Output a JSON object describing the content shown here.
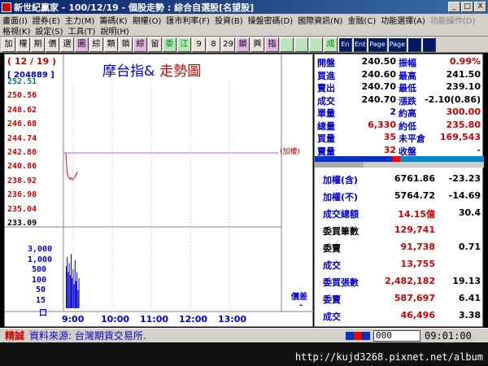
{
  "window": {
    "title": "新世紀贏家 - 100/12/19 - 個股走勢 : 綜合自選股[名望股]",
    "controls": [
      "_",
      "□",
      "X"
    ]
  },
  "menu1": [
    "畫面(I)",
    "證券(E)",
    "主力(M)",
    "籌碼(K)",
    "期權(O)",
    "匯市利率(F)",
    "投資(B)",
    "操盤密碼(D)",
    "國際資訊(N)",
    "金融(C)",
    "功能選擇(A)"
  ],
  "menu1_disabled": "功能操作(D)",
  "menu2": [
    "格視(K)",
    "設定(S)",
    "工具(T)",
    "說明(H)"
  ],
  "toolbar": [
    "加",
    "權",
    "期",
    "價",
    "選",
    "圖",
    "綜",
    "類",
    "鎖",
    "綜",
    "留",
    "委",
    "江",
    "9",
    "8",
    "29",
    "鎖",
    "興",
    "指",
    "",
    "",
    "",
    "成",
    "En",
    "Ent",
    "Page",
    "Page",
    "",
    ""
  ],
  "chart": {
    "date": "( 12 / 19 )",
    "code": "[ 204889 ]",
    "title_blue": "摩台指&",
    "title_red": "走勢圖",
    "ref_tag": "(加權)",
    "diff_label": "價差",
    "diff_value": "-"
  },
  "chart_data": {
    "type": "line",
    "y_ticks": [
      "252.51",
      "250.56",
      "248.62",
      "246.68",
      "244.74",
      "242.80",
      "240.86",
      "238.92",
      "236.98",
      "235.04",
      "233.09"
    ],
    "y_colors": [
      "teal",
      "red",
      "red",
      "red",
      "red",
      "red",
      "red",
      "red",
      "red",
      "red",
      "black"
    ],
    "ylim": [
      233.09,
      252.51
    ],
    "reference": 242.8,
    "x_ticks": [
      "9:00",
      "10:00",
      "11:00",
      "12:00",
      "13:00"
    ],
    "price_series": [
      242.8,
      240.0,
      239.5,
      239.2,
      239.4,
      239.1,
      239.3,
      239.5,
      239.9,
      240.2
    ],
    "volume_ticks": [
      "3,000",
      "1,000",
      "500",
      "100",
      "50",
      "15",
      "口"
    ],
    "volume_series": [
      0.7,
      0.85,
      0.6,
      0.75,
      0.55,
      0.9,
      0.5,
      0.65,
      0.4,
      0.8,
      0.45,
      0.6,
      0.3,
      0.5
    ]
  },
  "quote": [
    {
      "l1": "開盤",
      "v1": "240.50",
      "l2": "振幅",
      "v2": "0.99%",
      "c1": "black",
      "c2": "red"
    },
    {
      "l1": "買進",
      "v1": "240.60",
      "l2": "最高",
      "v2": "241.50",
      "c1": "black",
      "c2": "black"
    },
    {
      "l1": "賣出",
      "v1": "240.70",
      "l2": "最低",
      "v2": "239.10",
      "c1": "black",
      "c2": "black"
    },
    {
      "l1": "成交",
      "v1": "240.70",
      "l2": "漲跌",
      "v2": "-2.10(0.86)",
      "c1": "black",
      "c2": "black"
    },
    {
      "l1": "單量",
      "v1": "2",
      "l2": "約高",
      "v2": "300.00",
      "c1": "blue",
      "c2": "red"
    },
    {
      "l1": "總量",
      "v1": "6,330",
      "l2": "約低",
      "v2": "235.80",
      "c1": "red",
      "c2": "red"
    },
    {
      "l1": "買量",
      "v1": "35",
      "l2": "未平倉",
      "v2": "169,543",
      "c1": "red",
      "c2": "red"
    },
    {
      "l1": "賣量",
      "v1": "32",
      "l2": "收盤",
      "v2": "-",
      "c1": "red",
      "c2": "red"
    }
  ],
  "stats": [
    {
      "label": "加權(含)",
      "value": "6761.86",
      "change": "-23.23",
      "lc": "blue",
      "vc": "black",
      "cc": "black"
    },
    {
      "label": "加權(不)",
      "value": "5764.72",
      "change": "-14.69",
      "lc": "blue",
      "vc": "black",
      "cc": "black"
    },
    {
      "label": "成交總額",
      "value": "14.15億",
      "change": "30.4",
      "lc": "blue",
      "vc": "red",
      "cc": "black"
    },
    {
      "label": "委買筆數",
      "value": "129,741",
      "change": "",
      "lc": "black",
      "vc": "red",
      "cc": "black"
    },
    {
      "label": "委賣",
      "value": "91,738",
      "change": "0.71",
      "lc": "black",
      "vc": "red",
      "cc": "black"
    },
    {
      "label": "成交",
      "value": "13,755",
      "change": "",
      "lc": "blue",
      "vc": "red",
      "cc": "black"
    },
    {
      "label": "委買張數",
      "value": "2,482,182",
      "change": "19.13",
      "lc": "blue",
      "vc": "red",
      "cc": "black"
    },
    {
      "label": "委賣",
      "value": "587,697",
      "change": "6.41",
      "lc": "blue",
      "vc": "red",
      "cc": "black"
    },
    {
      "label": "成交",
      "value": "46,496",
      "change": "3.38",
      "lc": "blue",
      "vc": "red",
      "cc": "black"
    }
  ],
  "status": {
    "tag": "精誠",
    "source": "資料來源: 台灣期貨交易所.",
    "input_value": "000",
    "time": "09:01:00"
  },
  "watermark": "http://kujd3268.pixnet.net/album"
}
